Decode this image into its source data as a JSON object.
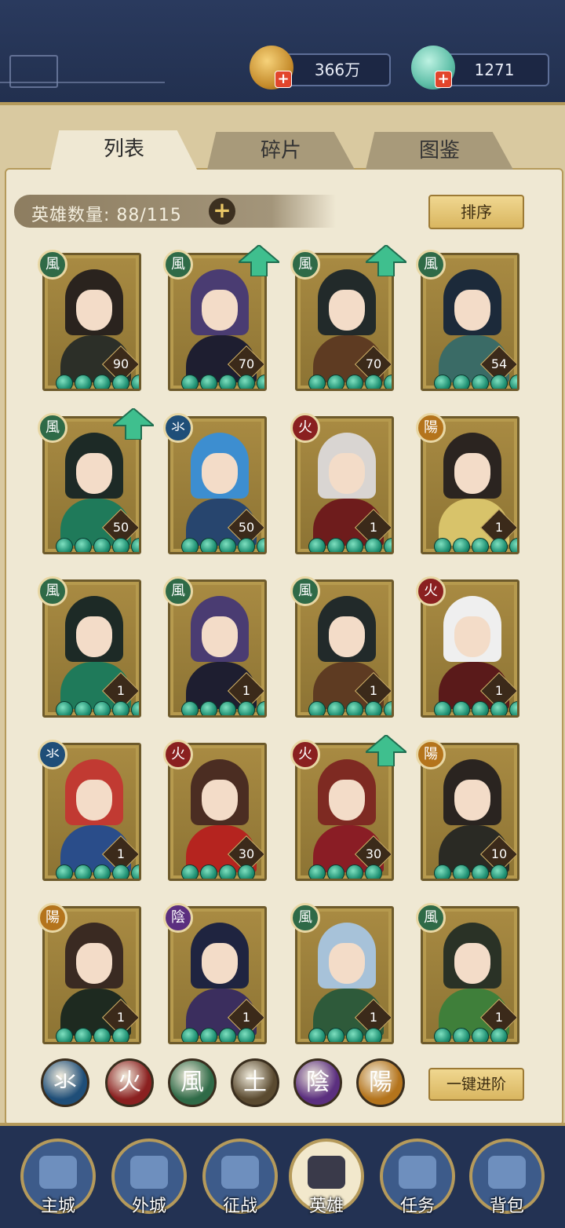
{
  "resources": {
    "coins": "366万",
    "jade": "1271"
  },
  "tabs": [
    {
      "label": "列表",
      "active": true
    },
    {
      "label": "碎片",
      "active": false
    },
    {
      "label": "图鉴",
      "active": false
    }
  ],
  "hero_count": {
    "label": "英雄数量:",
    "value": "88/115"
  },
  "sort_label": "排序",
  "advance_label": "一键进阶",
  "element_colors": {
    "wood": "#2f6a47",
    "water": "#1f4e78",
    "fire": "#8a2020",
    "earth": "#5a4a30",
    "yin": "#5b2f7f",
    "yang": "#b4741c"
  },
  "element_glyphs": {
    "wood": "風",
    "water": "氺",
    "fire": "火",
    "earth": "土",
    "yin": "陰",
    "yang": "陽"
  },
  "heroes": [
    {
      "element": "wood",
      "level": "90",
      "stars": 5,
      "upgrade": false,
      "hair": "#2a231e",
      "outfit": "#2c2f28"
    },
    {
      "element": "wood",
      "level": "70",
      "stars": 5,
      "upgrade": true,
      "hair": "#4a3c72",
      "outfit": "#1e1e30"
    },
    {
      "element": "wood",
      "level": "70",
      "stars": 5,
      "upgrade": true,
      "hair": "#222a2a",
      "outfit": "#5e3b22"
    },
    {
      "element": "wood",
      "level": "54",
      "stars": 5,
      "upgrade": false,
      "hair": "#1c2a3a",
      "outfit": "#3a6b66"
    },
    {
      "element": "wood",
      "level": "50",
      "stars": 5,
      "upgrade": true,
      "hair": "#1d2a26",
      "outfit": "#1f7a5a"
    },
    {
      "element": "water",
      "level": "50",
      "stars": 5,
      "upgrade": false,
      "hair": "#3d8ed0",
      "outfit": "#27456e"
    },
    {
      "element": "fire",
      "level": "1",
      "stars": 5,
      "upgrade": false,
      "hair": "#d9d5d2",
      "outfit": "#6e1c1c"
    },
    {
      "element": "yang",
      "level": "1",
      "stars": 5,
      "upgrade": false,
      "hair": "#2b2420",
      "outfit": "#d8c36a"
    },
    {
      "element": "wood",
      "level": "1",
      "stars": 5,
      "upgrade": false,
      "hair": "#1d2a26",
      "outfit": "#1f7a5a"
    },
    {
      "element": "wood",
      "level": "1",
      "stars": 5,
      "upgrade": false,
      "hair": "#4a3c72",
      "outfit": "#1e1e30"
    },
    {
      "element": "wood",
      "level": "1",
      "stars": 5,
      "upgrade": false,
      "hair": "#222a2a",
      "outfit": "#5e3b22"
    },
    {
      "element": "fire",
      "level": "1",
      "stars": 5,
      "upgrade": false,
      "hair": "#efefef",
      "outfit": "#5a1a1a"
    },
    {
      "element": "water",
      "level": "1",
      "stars": 5,
      "upgrade": false,
      "hair": "#c13a32",
      "outfit": "#2a4d8a"
    },
    {
      "element": "fire",
      "level": "30",
      "stars": 4,
      "upgrade": false,
      "hair": "#4b2d22",
      "outfit": "#b5241f"
    },
    {
      "element": "fire",
      "level": "30",
      "stars": 4,
      "upgrade": true,
      "hair": "#7e2a22",
      "outfit": "#8a1d25"
    },
    {
      "element": "yang",
      "level": "10",
      "stars": 4,
      "upgrade": false,
      "hair": "#2a2420",
      "outfit": "#2a2a24"
    },
    {
      "element": "yang",
      "level": "1",
      "stars": 4,
      "upgrade": false,
      "hair": "#3a2a22",
      "outfit": "#1e2a20"
    },
    {
      "element": "yin",
      "level": "1",
      "stars": 4,
      "upgrade": false,
      "hair": "#1f2440",
      "outfit": "#3b2e5e"
    },
    {
      "element": "wood",
      "level": "1",
      "stars": 4,
      "upgrade": false,
      "hair": "#a7c2d9",
      "outfit": "#2e5a3a"
    },
    {
      "element": "wood",
      "level": "1",
      "stars": 4,
      "upgrade": false,
      "hair": "#2a3226",
      "outfit": "#3f7f3a"
    }
  ],
  "element_filters": [
    "water",
    "fire",
    "wood",
    "earth",
    "yin",
    "yang"
  ],
  "bottom_nav": [
    {
      "label": "主城",
      "active": false
    },
    {
      "label": "外城",
      "active": false
    },
    {
      "label": "征战",
      "active": false
    },
    {
      "label": "英雄",
      "active": true
    },
    {
      "label": "任务",
      "active": false
    },
    {
      "label": "背包",
      "active": false
    }
  ]
}
